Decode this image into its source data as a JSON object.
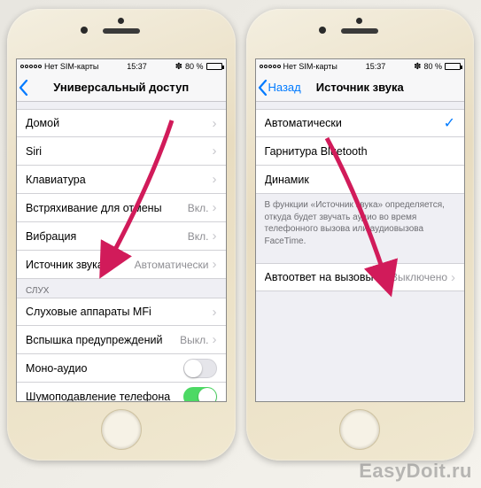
{
  "status": {
    "carrier_text": "Нет SIM-карты",
    "time": "15:37",
    "battery_pct": "80 %"
  },
  "phone1": {
    "nav_title": "Универсальный доступ",
    "rows": {
      "home": "Домой",
      "siri": "Siri",
      "keyboard": "Клавиатура",
      "shake": "Встряхивание для отмены",
      "shake_val": "Вкл.",
      "vibration": "Вибрация",
      "vibration_val": "Вкл.",
      "audio_source": "Источник звука",
      "audio_source_val": "Автоматически"
    },
    "hearing_header": "слух",
    "hearing_aids": "Слуховые аппараты MFi",
    "flash": "Вспышка предупреждений",
    "flash_val": "Выкл.",
    "mono": "Моно-аудио",
    "noise": "Шумоподавление телефона"
  },
  "phone2": {
    "back_label": "Назад",
    "nav_title": "Источник звука",
    "auto": "Автоматически",
    "bt": "Гарнитура Bluetooth",
    "speaker": "Динамик",
    "footer": "В функции «Источник звука» определяется, откуда будет звучать аудио во время телефонного вызова или аудиовызова FaceTime.",
    "auto_answer": "Автоответ на вызовы",
    "auto_answer_val": "Выключено"
  },
  "watermark": "EasyDoit.ru"
}
